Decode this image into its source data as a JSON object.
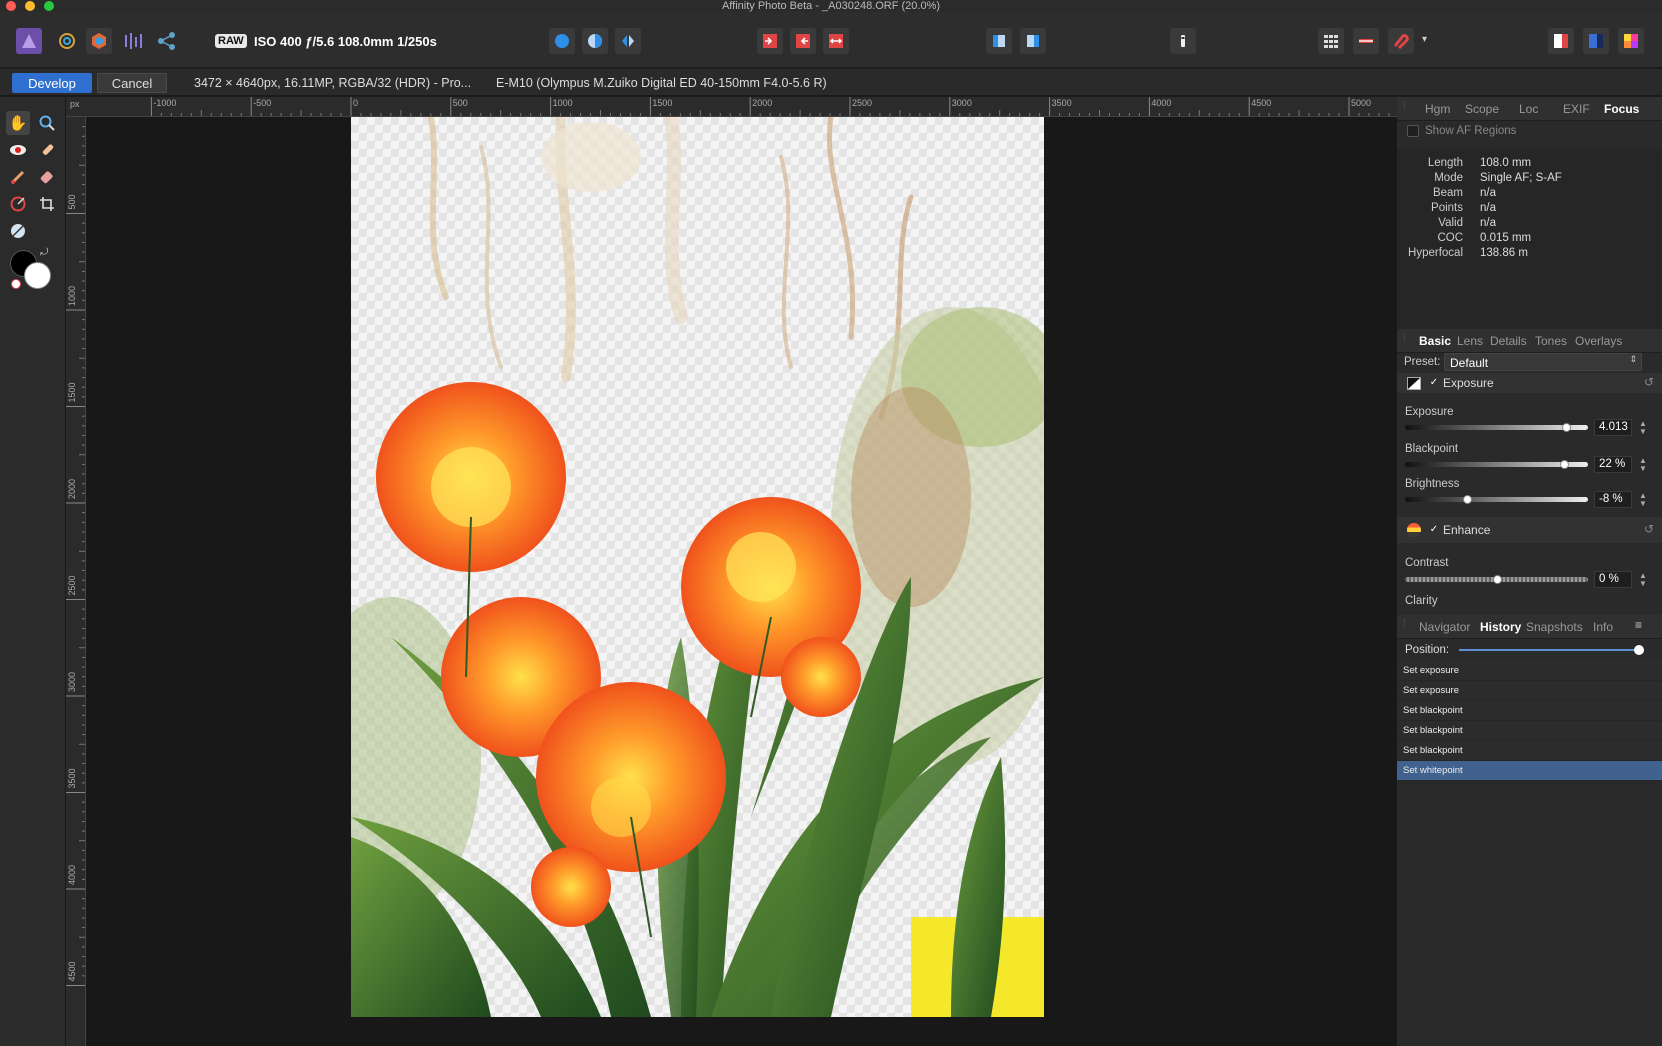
{
  "window": {
    "title": "Affinity Photo Beta - _A030248.ORF (20.0%)"
  },
  "toolbar": {
    "raw_badge": "RAW",
    "exif_summary": "ISO 400 ƒ/5.6 108.0mm 1/250s"
  },
  "context": {
    "develop_label": "Develop",
    "cancel_label": "Cancel",
    "image_info": "3472 × 4640px, 16.11MP, RGBA/32 (HDR) - Pro...",
    "lens_info": "E-M10 (Olympus M.Zuiko Digital ED 40-150mm F4.0-5.6 R)"
  },
  "ruler": {
    "unit": "px",
    "h_labels": [
      "-1000",
      "-500",
      "0",
      "500",
      "1000",
      "1500",
      "2000",
      "2500",
      "3000",
      "3500",
      "4000",
      "4500",
      "5000"
    ],
    "v_labels": [
      "500",
      "1000",
      "1500",
      "2000",
      "2500",
      "3000",
      "3500",
      "4000",
      "4500"
    ]
  },
  "panel_top": {
    "tabs": [
      "Hgm",
      "Scope",
      "Loc",
      "EXIF",
      "Focus"
    ],
    "active_tab": "Focus",
    "show_af_label": "Show AF Regions",
    "focus_info": [
      {
        "key": "Length",
        "value": "108.0 mm"
      },
      {
        "key": "Mode",
        "value": "Single AF; S-AF"
      },
      {
        "key": "Beam",
        "value": "n/a"
      },
      {
        "key": "Points",
        "value": "n/a"
      },
      {
        "key": "Valid",
        "value": "n/a"
      },
      {
        "key": "COC",
        "value": "0.015 mm"
      },
      {
        "key": "Hyperfocal",
        "value": "138.86 m"
      }
    ]
  },
  "panel_mid": {
    "tabs": [
      "Basic",
      "Lens",
      "Details",
      "Tones",
      "Overlays"
    ],
    "active_tab": "Basic",
    "preset_label": "Preset:",
    "preset_value": "Default",
    "exposure_section": "Exposure",
    "exposure": {
      "label": "Exposure",
      "value": "4.013",
      "level": 0.88
    },
    "blackpoint": {
      "label": "Blackpoint",
      "value": "22 %",
      "level": 0.87
    },
    "brightness": {
      "label": "Brightness",
      "value": "-8 %",
      "level": 0.34
    },
    "enhance_section": "Enhance",
    "contrast": {
      "label": "Contrast",
      "value": "0 %",
      "level": 0.5
    },
    "clarity_label": "Clarity"
  },
  "panel_bottom": {
    "tabs": [
      "Navigator",
      "History",
      "Snapshots",
      "Info"
    ],
    "active_tab": "History",
    "position_label": "Position:",
    "position_level": 1.0,
    "history": [
      "Set exposure",
      "Set exposure",
      "Set blackpoint",
      "Set blackpoint",
      "Set blackpoint",
      "Set whitepoint"
    ],
    "selected_index": 5
  },
  "colors": {
    "accent": "#2f6fd0",
    "history_selected": "#41628f"
  }
}
